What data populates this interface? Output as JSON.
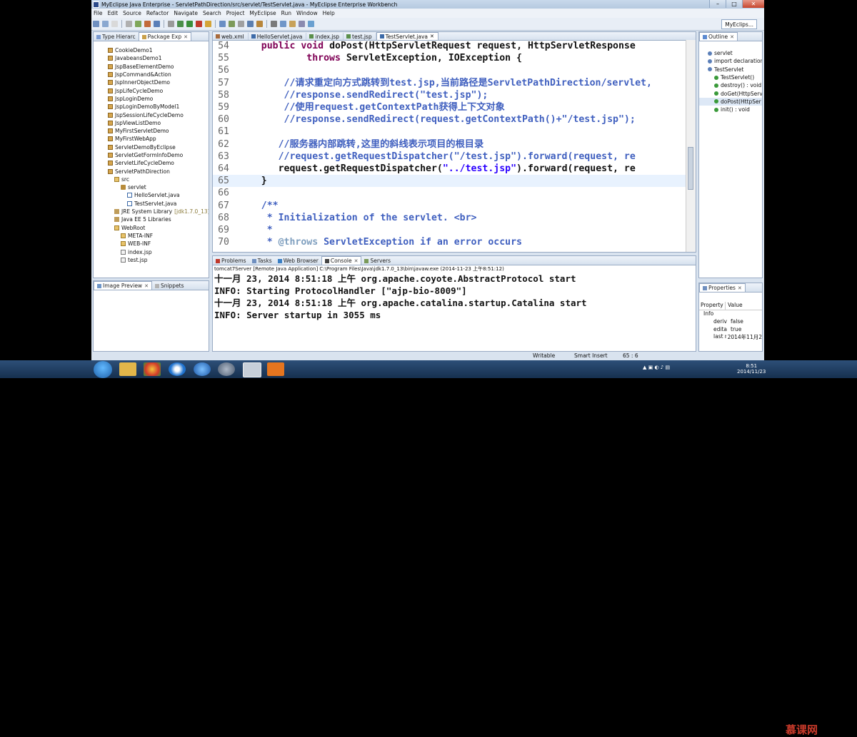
{
  "window": {
    "title": "MyEclipse Java Enterprise - ServletPathDirection/src/servlet/TestServlet.java - MyEclipse Enterprise Workbench",
    "min": "–",
    "max": "□",
    "close": "✕"
  },
  "menu": [
    "File",
    "Edit",
    "Source",
    "Refactor",
    "Navigate",
    "Search",
    "Project",
    "MyEclipse",
    "Run",
    "Window",
    "Help"
  ],
  "perspective": "MyEclips...",
  "left_tabs": [
    {
      "label": "Type Hierarc"
    },
    {
      "label": "Package Exp"
    }
  ],
  "tree": [
    {
      "label": "CookieDemo1",
      "icon": "project",
      "indent": 0
    },
    {
      "label": "JavabeansDemo1",
      "icon": "project",
      "indent": 0
    },
    {
      "label": "JspBaseElementDemo",
      "icon": "project",
      "indent": 0
    },
    {
      "label": "JspCommand&Action",
      "icon": "project",
      "indent": 0
    },
    {
      "label": "JspInnerObjectDemo",
      "icon": "project",
      "indent": 0
    },
    {
      "label": "JspLifeCycleDemo",
      "icon": "project",
      "indent": 0
    },
    {
      "label": "JspLoginDemo",
      "icon": "project",
      "indent": 0
    },
    {
      "label": "JspLoginDemoByModel1",
      "icon": "project",
      "indent": 0
    },
    {
      "label": "JspSessionLifeCycleDemo",
      "icon": "project",
      "indent": 0
    },
    {
      "label": "JspViewListDemo",
      "icon": "project",
      "indent": 0
    },
    {
      "label": "MyFirstServletDemo",
      "icon": "project",
      "indent": 0
    },
    {
      "label": "MyFirstWebApp",
      "icon": "project",
      "indent": 0
    },
    {
      "label": "ServletDemoByEclipse",
      "icon": "project",
      "indent": 0
    },
    {
      "label": "ServletGetFormInfoDemo",
      "icon": "project",
      "indent": 0
    },
    {
      "label": "ServletLifeCycleDemo",
      "icon": "project",
      "indent": 0
    },
    {
      "label": "ServletPathDirection",
      "icon": "project",
      "indent": 0
    },
    {
      "label": "src",
      "icon": "folder",
      "indent": 1
    },
    {
      "label": "servlet",
      "icon": "package",
      "indent": 2
    },
    {
      "label": "HelloServlet.java",
      "icon": "java",
      "indent": 3
    },
    {
      "label": "TestServlet.java",
      "icon": "java",
      "indent": 3
    },
    {
      "label": "JRE System Library",
      "suffix": "[jdk1.7.0_13]",
      "icon": "lib",
      "indent": 1
    },
    {
      "label": "Java EE 5 Libraries",
      "icon": "lib",
      "indent": 1
    },
    {
      "label": "WebRoot",
      "icon": "folder",
      "indent": 1
    },
    {
      "label": "META-INF",
      "icon": "folder",
      "indent": 2
    },
    {
      "label": "WEB-INF",
      "icon": "folder",
      "indent": 2
    },
    {
      "label": "index.jsp",
      "icon": "file",
      "indent": 2
    },
    {
      "label": "test.jsp",
      "icon": "file",
      "indent": 2
    }
  ],
  "bottom_left_tabs": [
    {
      "label": "Image Preview"
    },
    {
      "label": "Snippets"
    }
  ],
  "editor_tabs": [
    {
      "label": "web.xml",
      "active": false
    },
    {
      "label": "HelloServlet.java",
      "active": false
    },
    {
      "label": "index.jsp",
      "active": false
    },
    {
      "label": "test.jsp",
      "active": false
    },
    {
      "label": "TestServlet.java",
      "active": true
    }
  ],
  "code": [
    {
      "num": "54",
      "text": "    public void doPost(HttpServletRequest request, HttpServletResponse",
      "kind": "sig"
    },
    {
      "num": "55",
      "text": "            throws ServletException, IOException {",
      "kind": "throws"
    },
    {
      "num": "56",
      "text": "",
      "kind": "plain"
    },
    {
      "num": "57",
      "text": "        //请求重定向方式跳转到test.jsp,当前路径是ServletPathDirection/servlet,",
      "kind": "cm"
    },
    {
      "num": "58",
      "text": "        //response.sendRedirect(\"test.jsp\");",
      "kind": "cm"
    },
    {
      "num": "59",
      "text": "        //使用request.getContextPath获得上下文对象",
      "kind": "cm"
    },
    {
      "num": "60",
      "text": "        //response.sendRedirect(request.getContextPath()+\"/test.jsp\");",
      "kind": "cm"
    },
    {
      "num": "61",
      "text": "",
      "kind": "plain"
    },
    {
      "num": "62",
      "text": "       //服务器内部跳转,这里的斜线表示项目的根目录",
      "kind": "cm"
    },
    {
      "num": "63",
      "text": "       //request.getRequestDispatcher(\"/test.jsp\").forward(request, re",
      "kind": "cm"
    },
    {
      "num": "64",
      "text": "       request.getRequestDispatcher(\"../test.jsp\").forward(request, re",
      "kind": "dispatch"
    },
    {
      "num": "65",
      "text": "    }",
      "kind": "plain"
    },
    {
      "num": "66",
      "text": "",
      "kind": "plain"
    },
    {
      "num": "67",
      "text": "    /**",
      "kind": "jd"
    },
    {
      "num": "68",
      "text": "     * Initialization of the servlet. <br>",
      "kind": "jd"
    },
    {
      "num": "69",
      "text": "     *",
      "kind": "jd"
    },
    {
      "num": "70",
      "text": "     * @throws ServletException if an error occurs",
      "kind": "jd"
    }
  ],
  "current_line": "65",
  "outline_tab": "Outline",
  "outline": [
    {
      "label": "servlet",
      "indent": 0
    },
    {
      "label": "import declarations",
      "indent": 0
    },
    {
      "label": "TestServlet",
      "indent": 0
    },
    {
      "label": "TestServlet()",
      "indent": 1
    },
    {
      "label": "destroy() : void",
      "indent": 1
    },
    {
      "label": "doGet(HttpServ",
      "indent": 1
    },
    {
      "label": "doPost(HttpSer",
      "indent": 1,
      "selected": true
    },
    {
      "label": "init() : void",
      "indent": 1
    }
  ],
  "properties": {
    "tab": "Properties",
    "headers": [
      "Property",
      "Value"
    ],
    "group": "Info",
    "rows": [
      {
        "key": "deriv",
        "value": "false"
      },
      {
        "key": "edita",
        "value": "true"
      },
      {
        "key": "last r",
        "value": "2014年11月2"
      }
    ]
  },
  "console_tabs": [
    {
      "label": "Problems",
      "active": false
    },
    {
      "label": "Tasks",
      "active": false
    },
    {
      "label": "Web Browser",
      "active": false
    },
    {
      "label": "Console",
      "active": true
    },
    {
      "label": "Servers",
      "active": false
    }
  ],
  "console_info": "tomcat7Server [Remote Java Application] C:\\Program Files\\Java\\jdk1.7.0_13\\bin\\javaw.exe (2014-11-23 上午8:51:12)",
  "console_lines": [
    "十一月 23, 2014 8:51:18 上午 org.apache.coyote.AbstractProtocol start",
    "INFO: Starting ProtocolHandler [\"ajp-bio-8009\"]",
    "十一月 23, 2014 8:51:18 上午 org.apache.catalina.startup.Catalina start",
    "INFO: Server startup in 3055 ms"
  ],
  "status": {
    "mode": "Writable",
    "insert": "Smart Insert",
    "pos": "65 : 6"
  },
  "clock": {
    "time": "8:51",
    "date": "2014/11/23"
  },
  "watermark": "慕课网",
  "colors": {
    "keyword": "#7f0055",
    "comment": "#3f5fbf",
    "string": "#2a00ff",
    "current_line": "#e8f2fe"
  }
}
